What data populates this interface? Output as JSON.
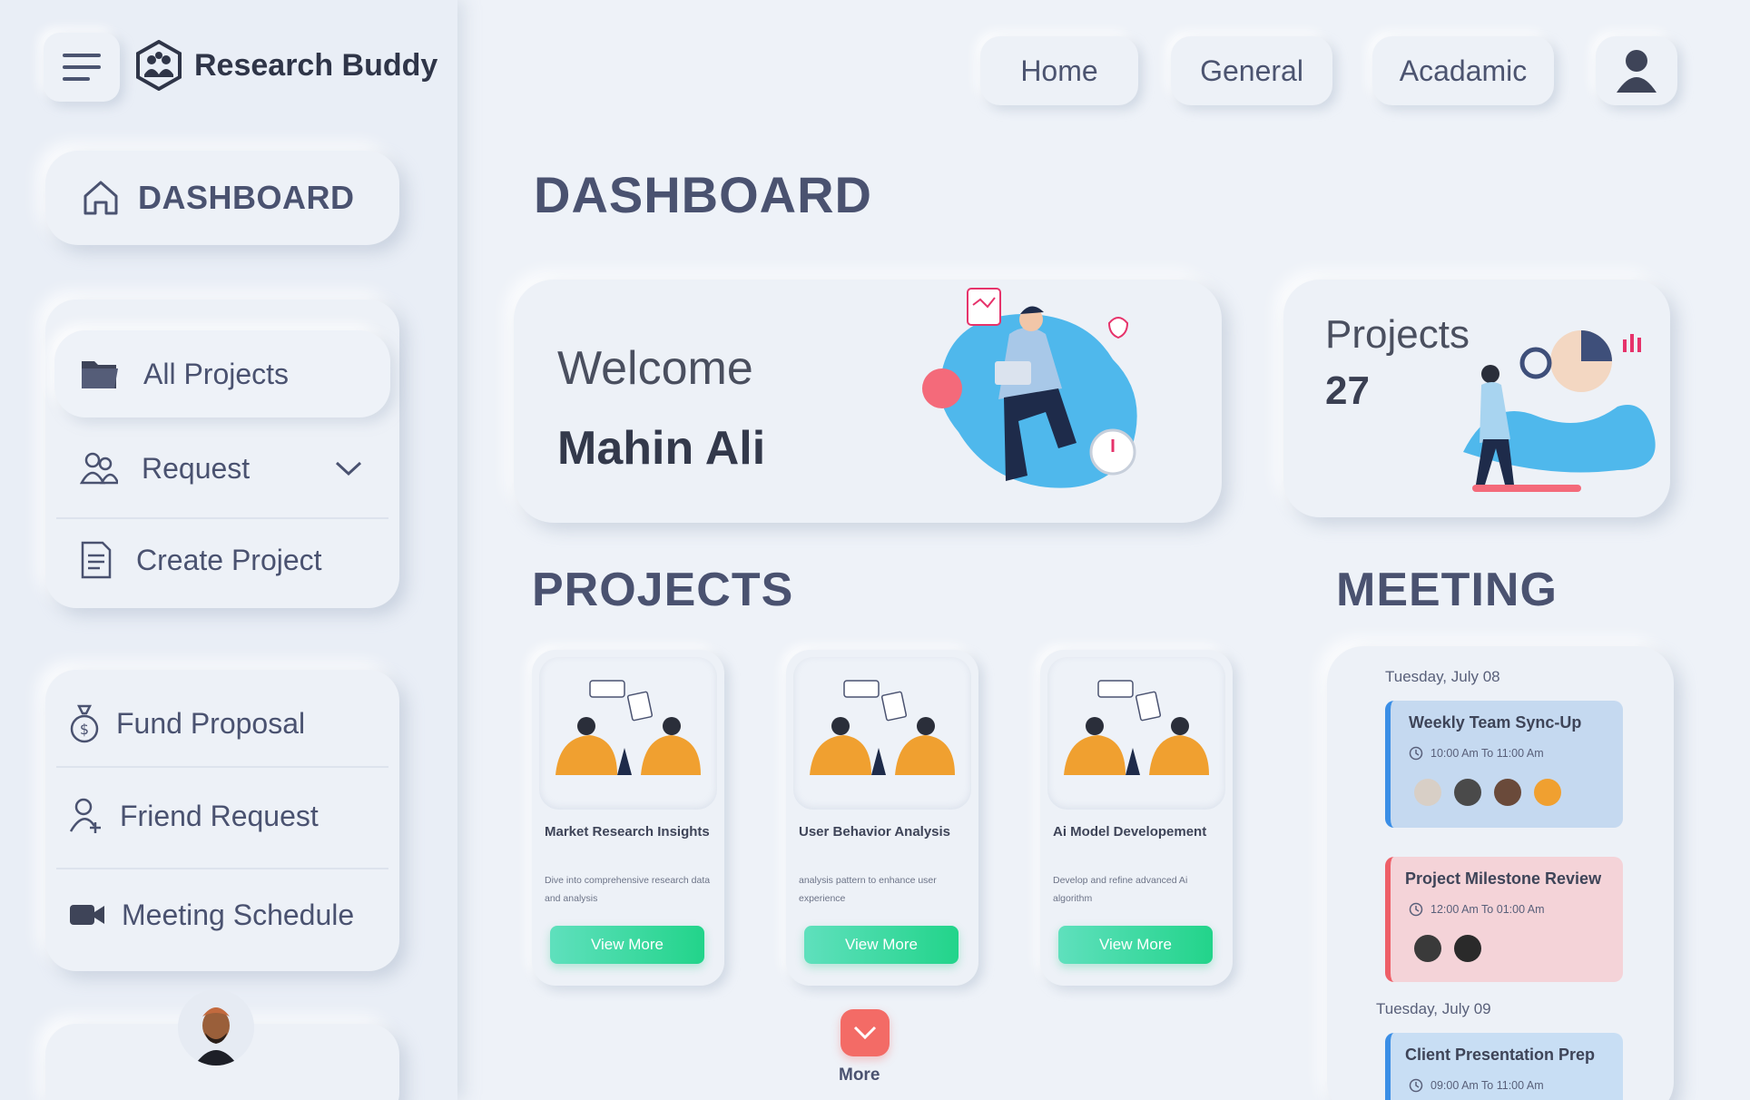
{
  "app": {
    "name": "Research Buddy"
  },
  "topnav": {
    "home": "Home",
    "general": "General",
    "academic": "Acadamic"
  },
  "sidebar": {
    "dashboard": "DASHBOARD",
    "items": [
      {
        "label": "All Projects"
      },
      {
        "label": "Request"
      },
      {
        "label": "Create Project"
      },
      {
        "label": "Fund Proposal"
      },
      {
        "label": "Friend Request"
      },
      {
        "label": "Meeting Schedule"
      }
    ]
  },
  "main": {
    "title": "DASHBOARD",
    "welcome": {
      "greeting": "Welcome",
      "name": "Mahin Ali"
    },
    "projects_summary": {
      "label": "Projects",
      "count": "27"
    },
    "projects_title": "PROJECTS",
    "meeting_title": "MEETING",
    "projects": [
      {
        "title": "Market Research Insights",
        "desc": "Dive into comprehensive research data and analysis",
        "button": "View More"
      },
      {
        "title": "User Behavior Analysis",
        "desc": "analysis pattern to enhance user experience",
        "button": "View More"
      },
      {
        "title": "Ai Model Developement",
        "desc": "Develop and refine advanced Ai algorithm",
        "button": "View More"
      }
    ],
    "more": "More",
    "meetings": [
      {
        "date": "Tuesday, July 08",
        "title": "Weekly Team Sync-Up",
        "time": "10:00 Am To 11:00 Am"
      },
      {
        "title": "Project Milestone Review",
        "time": "12:00 Am To 01:00 Am"
      },
      {
        "date": "Tuesday, July 09",
        "title": "Client Presentation Prep",
        "time": "09:00 Am To 11:00 Am"
      }
    ]
  },
  "colors": {
    "background": "#eef2f8",
    "accent_green": "#22d48a",
    "accent_red": "#f36b66",
    "meeting_blue": "#c5d9f0",
    "meeting_pink": "#f4d3d8",
    "illustration_blue": "#4fb8ec"
  },
  "icons": {
    "menu": "hamburger-icon",
    "logo": "team-logo-icon",
    "dashboard": "home-icon",
    "all_projects": "folder-icon",
    "request": "users-icon",
    "create_project": "document-icon",
    "fund_proposal": "money-bag-icon",
    "friend_request": "user-plus-icon",
    "meeting_schedule": "video-camera-icon",
    "user": "user-icon",
    "more": "chevron-down-icon",
    "clock": "clock-icon"
  }
}
